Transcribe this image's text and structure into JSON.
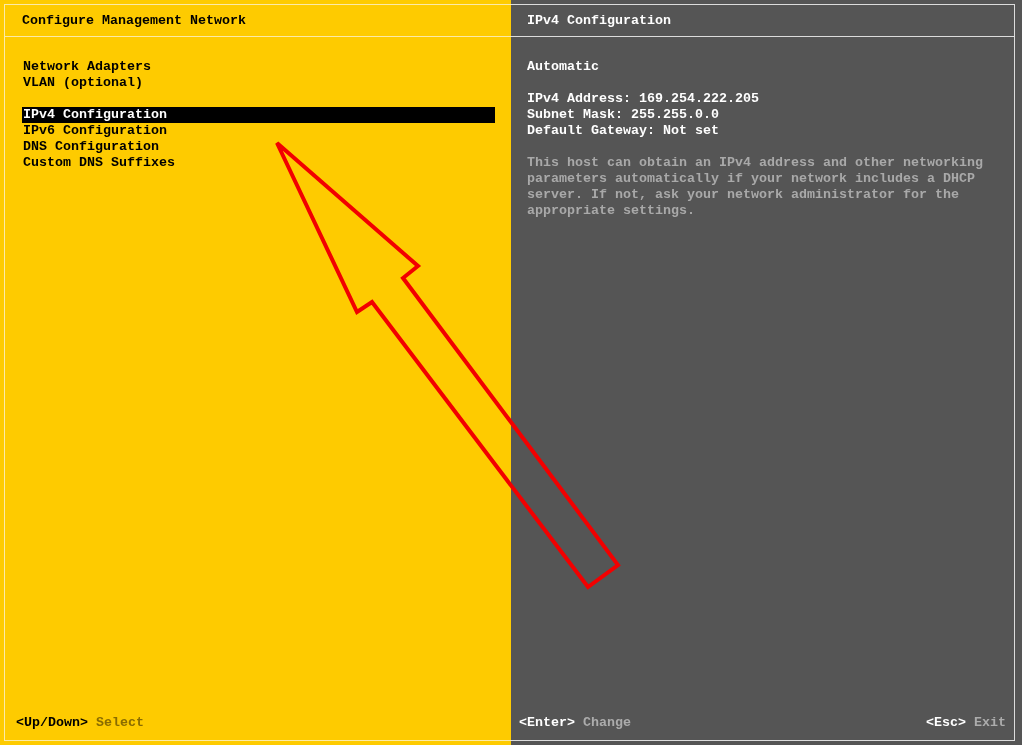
{
  "left_panel": {
    "title": "Configure Management Network",
    "menu_groups": [
      {
        "items": [
          {
            "label": "Network Adapters",
            "selected": false
          },
          {
            "label": "VLAN (optional)",
            "selected": false
          }
        ]
      },
      {
        "items": [
          {
            "label": "IPv4 Configuration",
            "selected": true
          },
          {
            "label": "IPv6 Configuration",
            "selected": false
          },
          {
            "label": "DNS Configuration",
            "selected": false
          },
          {
            "label": "Custom DNS Suffixes",
            "selected": false
          }
        ]
      }
    ],
    "footer_hints": [
      {
        "key": "<Up/Down>",
        "action": "Select"
      }
    ]
  },
  "right_panel": {
    "title": "IPv4 Configuration",
    "mode": "Automatic",
    "details": [
      "IPv4 Address: 169.254.222.205",
      "Subnet Mask: 255.255.0.0",
      "Default Gateway: Not set"
    ],
    "description": "This host can obtain an IPv4 address and other networking parameters automatically if your network includes a DHCP server. If not, ask your network administrator for the appropriate settings.",
    "footer_hints": [
      {
        "key": "<Enter>",
        "action": "Change"
      },
      {
        "key": "<Esc>",
        "action": "Exit"
      }
    ]
  },
  "annotations": [
    {
      "kind": "arrow"
    }
  ]
}
